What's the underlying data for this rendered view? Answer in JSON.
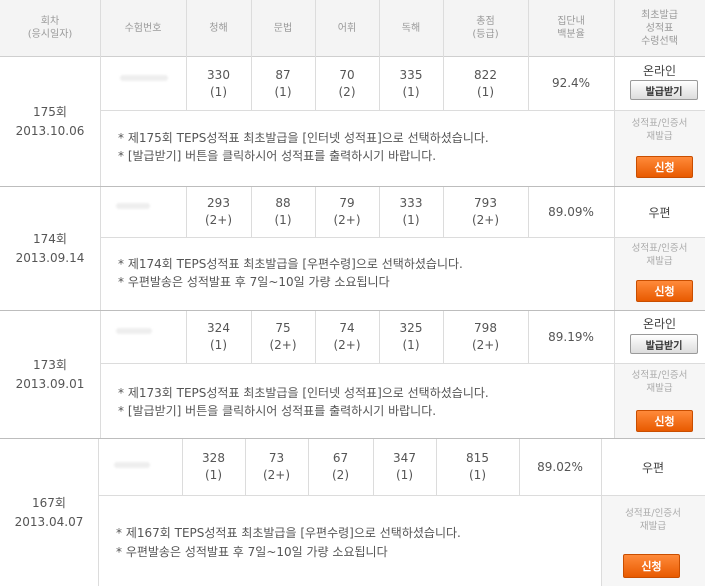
{
  "header": {
    "round_date": "회차\n(응시일자)",
    "exam_no": "수험번호",
    "listening": "청해",
    "grammar": "문법",
    "vocab": "어휘",
    "reading": "독해",
    "total": "총점\n(등급)",
    "percentile": "집단내\n백분율",
    "first_issue": "최초발급\n성적표\n수령선택"
  },
  "reissue_label": "성적표/인증서\n재발급",
  "apply_label": "신청",
  "receive_label": "발급받기",
  "rows": [
    {
      "round": "175회\n2013.10.06",
      "listening": "330\n(1)",
      "grammar": "87\n(1)",
      "vocab": "70\n(2)",
      "reading": "335\n(1)",
      "total": "822\n(1)",
      "percentile": "92.4%",
      "method": "온라인",
      "note1": "* 제175회 TEPS성적표 최초발급을 [인터넷 성적표]으로 선택하셨습니다.",
      "note2": "* [발급받기] 버튼을 클릭하시어 성적표를 출력하시기 바랍니다."
    },
    {
      "round": "174회\n2013.09.14",
      "listening": "293\n(2+)",
      "grammar": "88\n(1)",
      "vocab": "79\n(2+)",
      "reading": "333\n(1)",
      "total": "793\n(2+)",
      "percentile": "89.09%",
      "method": "우편",
      "note1": "* 제174회 TEPS성적표 최초발급을 [우편수령]으로 선택하셨습니다.",
      "note2": "* 우편발송은 성적발표 후 7일~10일 가량 소요됩니다"
    },
    {
      "round": "173회\n2013.09.01",
      "listening": "324\n(1)",
      "grammar": "75\n(2+)",
      "vocab": "74\n(2+)",
      "reading": "325\n(1)",
      "total": "798\n(2+)",
      "percentile": "89.19%",
      "method": "온라인",
      "note1": "* 제173회 TEPS성적표 최초발급을 [인터넷 성적표]으로 선택하셨습니다.",
      "note2": "* [발급받기] 버튼을 클릭하시어 성적표를 출력하시기 바랍니다."
    },
    {
      "round": "167회\n2013.04.07",
      "listening": "328\n(1)",
      "grammar": "73\n(2+)",
      "vocab": "67\n(2)",
      "reading": "347\n(1)",
      "total": "815\n(1)",
      "percentile": "89.02%",
      "method": "우편",
      "note1": "* 제167회 TEPS성적표 최초발급을 [우편수령]으로 선택하셨습니다.",
      "note2": "* 우편발송은 성적발표 후 7일~10일 가량 소요됩니다"
    }
  ]
}
